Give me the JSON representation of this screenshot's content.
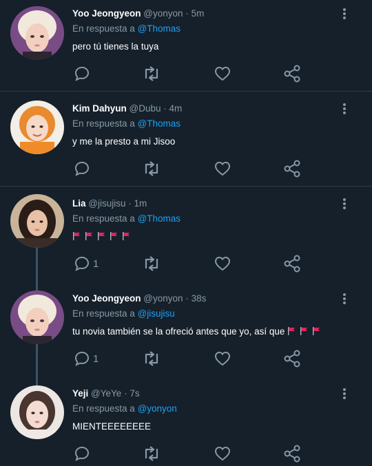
{
  "reply_prefix": "En respuesta a",
  "separator": "·",
  "colors": {
    "background": "#15202b",
    "link": "#1da1f2",
    "muted": "#8899a6",
    "flag": "#e0245e"
  },
  "tweets": [
    {
      "name": "Yoo Jeongyeon",
      "handle": "@yonyon",
      "time": "5m",
      "reply_to": "@Thomas",
      "text": "pero tú tienes la tuya",
      "reply_count": ""
    },
    {
      "name": "Kim Dahyun",
      "handle": "@Dubu",
      "time": "4m",
      "reply_to": "@Thomas",
      "text": "y me la presto a mi Jisoo",
      "reply_count": ""
    },
    {
      "name": "Lia",
      "handle": "@jisujisu",
      "time": "1m",
      "reply_to": "@Thomas",
      "text": "",
      "flags": 5,
      "reply_count": "1"
    },
    {
      "name": "Yoo Jeongyeon",
      "handle": "@yonyon",
      "time": "38s",
      "reply_to": "@jisujisu",
      "text": "tu novia también se la ofreció antes que yo, así que",
      "flags": 3,
      "reply_count": "1"
    },
    {
      "name": "Yeji",
      "handle": "@YeYe",
      "time": "7s",
      "reply_to": "@yonyon",
      "text": "MIENTEEEEEEEE",
      "reply_count": ""
    }
  ],
  "icons": {
    "reply": "reply-icon",
    "retweet": "retweet-icon",
    "like": "heart-icon",
    "share": "share-icon",
    "more": "more-options-icon"
  }
}
